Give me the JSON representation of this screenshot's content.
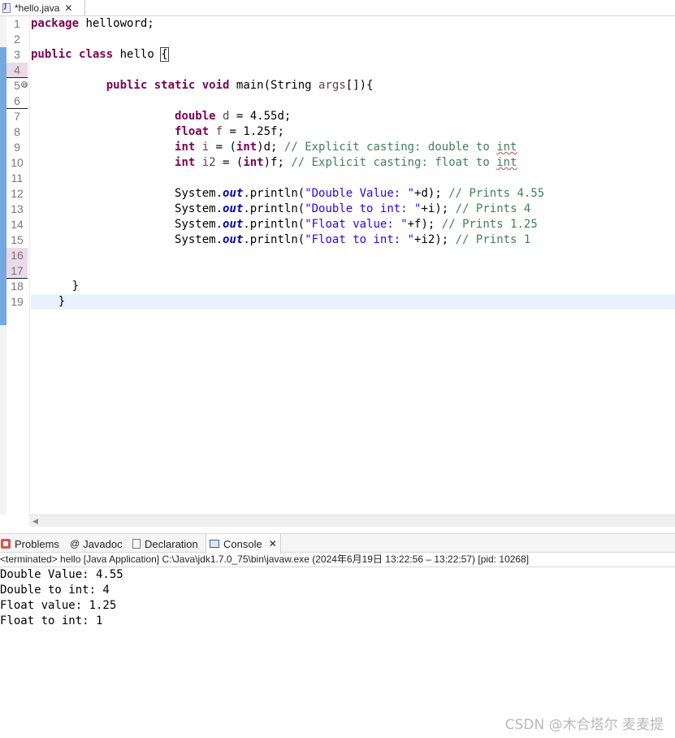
{
  "editor_tab": {
    "title": "*hello.java",
    "close": "✕",
    "icon": "java-file-icon"
  },
  "line_numbers": [
    "1",
    "2",
    "3",
    "4",
    "5",
    "6",
    "7",
    "8",
    "9",
    "10",
    "11",
    "12",
    "13",
    "14",
    "15",
    "16",
    "17",
    "18",
    "19"
  ],
  "fold_marker": "⊖",
  "code": {
    "l1_kw": "package",
    "l1_rest": " helloword;",
    "l3_kw1": "public",
    "l3_kw2": "class",
    "l3_name": " hello ",
    "l3_brace": "{",
    "l5_kw1": "public",
    "l5_kw2": "static",
    "l5_kw3": "void",
    "l5_rest1": " main(String ",
    "l5_param": "args",
    "l5_rest2": "[]){",
    "l7_kw": "double",
    "l7_var": " d",
    "l7_rest": " = 4.55d;",
    "l8_kw": "float",
    "l8_var": " f",
    "l8_rest": " = 1.25f;",
    "l9_kw": "int",
    "l9_var": " i",
    "l9_mid": " = (",
    "l9_cast": "int",
    "l9_var2": ")d",
    "l9_semi": "; ",
    "l9_cm": "// Explicit casting: double to ",
    "l9_cm_sq": "int",
    "l10_kw": "int",
    "l10_var": " i2",
    "l10_mid": " = (",
    "l10_cast": "int",
    "l10_var2": ")f",
    "l10_semi": "; ",
    "l10_cm": "// Explicit casting: float to ",
    "l10_cm_sq": "int",
    "l12_a": "System.",
    "l12_out": "out",
    "l12_b": ".println(",
    "l12_str": "\"Double Value: \"",
    "l12_c": "+d); ",
    "l12_cm": "// Prints 4.55",
    "l13_a": "System.",
    "l13_out": "out",
    "l13_b": ".println(",
    "l13_str": "\"Double to int: \"",
    "l13_c": "+i); ",
    "l13_cm": "// Prints 4",
    "l14_a": "System.",
    "l14_out": "out",
    "l14_b": ".println(",
    "l14_str": "\"Float value: \"",
    "l14_c": "+f); ",
    "l14_cm": "// Prints 1.25",
    "l15_a": "System.",
    "l15_out": "out",
    "l15_b": ".println(",
    "l15_str": "\"Float to int: \"",
    "l15_c": "+i2); ",
    "l15_cm": "// Prints 1",
    "l18": "}",
    "l19": "}"
  },
  "views_tabs": {
    "problems": "Problems",
    "javadoc": "Javadoc",
    "javadoc_icon": "@",
    "declaration": "Declaration",
    "console": "Console",
    "console_close": "✕"
  },
  "console": {
    "header": "<terminated> hello [Java Application] C:\\Java\\jdk1.7.0_75\\bin\\javaw.exe  (2024年6月19日 13:22:56 – 13:22:57) [pid: 10268]",
    "lines": [
      "Double Value: 4.55",
      "Double to int: 4",
      "Float value: 1.25",
      "Float to int: 1"
    ]
  },
  "watermark": "CSDN @木合塔尔 麦麦提",
  "colors": {
    "keyword": "#7f0055",
    "comment": "#3f7f5f",
    "string": "#2a00ff",
    "field": "#0000c0",
    "current_line": "#e8f2fe"
  }
}
